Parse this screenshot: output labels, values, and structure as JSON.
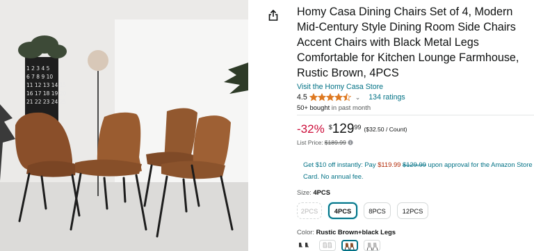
{
  "product": {
    "title": "Homy Casa Dining Chairs Set of 4, Modern Mid-Century Style Dining Room Side Chairs Accent Chairs with Black Metal Legs Comfortable for Kitchen Lounge Farmhouse, Rustic Brown, 4PCS",
    "store_link": "Visit the Homy Casa Store",
    "rating_value": "4.5",
    "rating_stars": 4.5,
    "ratings_count": "134 ratings",
    "bought_count": "50+ bought",
    "bought_suffix": " in past month"
  },
  "price": {
    "discount": "-32%",
    "currency": "$",
    "whole": "129",
    "fraction": "99",
    "unit_price": "($32.50 / Count)",
    "list_label": "List Price: ",
    "list_value": "$189.99"
  },
  "promo": {
    "text_a": "Get $10 off instantly: Pay ",
    "pay_price": "$119.99",
    "text_b": " ",
    "original": "$129.99",
    "text_c": " upon approval for the Amazon Store Card. No annual fee."
  },
  "size": {
    "label": "Size: ",
    "selected": "4PCS",
    "options": [
      "2PCS",
      "4PCS",
      "8PCS",
      "12PCS"
    ]
  },
  "color": {
    "label": "Color: ",
    "selected": "Rustic Brown+black Legs"
  },
  "image": {
    "calendar_numbers": [
      "1 2 3 4 5",
      "6 7 8 9 10",
      "11 12 13 14 15",
      "16 17 18 19 20",
      "21 22 23 24 25"
    ]
  },
  "colors": {
    "link": "#007185",
    "discount": "#cc0c39",
    "star": "#de7921",
    "selected_border": "#007185"
  }
}
